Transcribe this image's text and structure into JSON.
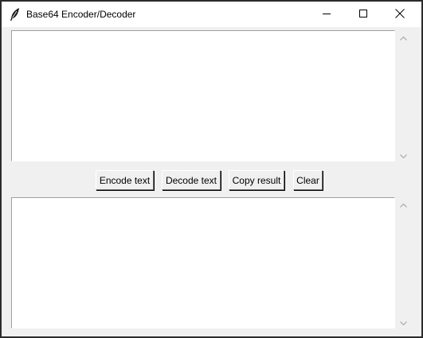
{
  "window": {
    "title": "Base64 Encoder/Decoder",
    "icon": "feather-icon"
  },
  "titlebar_controls": [
    "minimize-icon",
    "maximize-icon",
    "close-icon"
  ],
  "input_area": {
    "value": ""
  },
  "output_area": {
    "value": ""
  },
  "buttons": {
    "encode_label": "Encode text",
    "decode_label": "Decode text",
    "copy_label": "Copy result",
    "clear_label": "Clear"
  },
  "colors": {
    "window_bg": "#f0f0f0",
    "titlebar_bg": "#ffffff",
    "text_bg": "#ffffff",
    "outer_frame": "#2b2b2b"
  }
}
